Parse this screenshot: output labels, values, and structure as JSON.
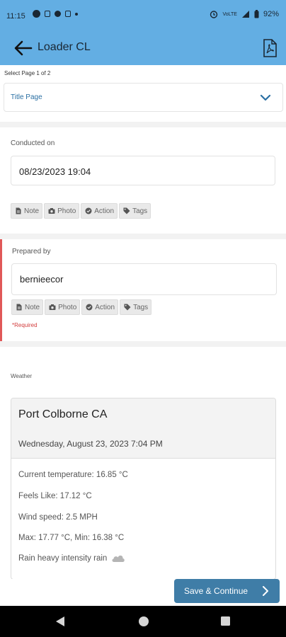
{
  "status_bar": {
    "time": "11:15",
    "battery": "92%",
    "network": "VoLTE"
  },
  "app_bar": {
    "title": "Loader CL",
    "back_icon": "arrow-left-icon",
    "pdf_icon": "pdf-icon"
  },
  "page_select": {
    "label": "Select Page 1 of 2",
    "value": "Title Page"
  },
  "conducted": {
    "label": "Conducted on",
    "value": "08/23/2023 19:04"
  },
  "prepared": {
    "label": "Prepared by",
    "value": "bernieecor",
    "required": "*Required"
  },
  "chips": {
    "note": "Note",
    "photo": "Photo",
    "action": "Action",
    "tags": "Tags"
  },
  "weather": {
    "label": "Weather",
    "city": "Port Colborne CA",
    "datetime": "Wednesday, August 23, 2023 7:04 PM",
    "temperature": "Current temperature: 16.85 °C",
    "feels_like": "Feels Like: 17.12 °C",
    "wind": "Wind speed: 2.5 MPH",
    "maxmin": "Max: 17.77 °C, Min: 16.38 °C",
    "condition": "Rain heavy intensity rain"
  },
  "footer": {
    "save_label": "Save & Continue"
  },
  "colors": {
    "app_bar": "#63aee3",
    "button": "#3f7da7",
    "required": "#d23c3c"
  }
}
